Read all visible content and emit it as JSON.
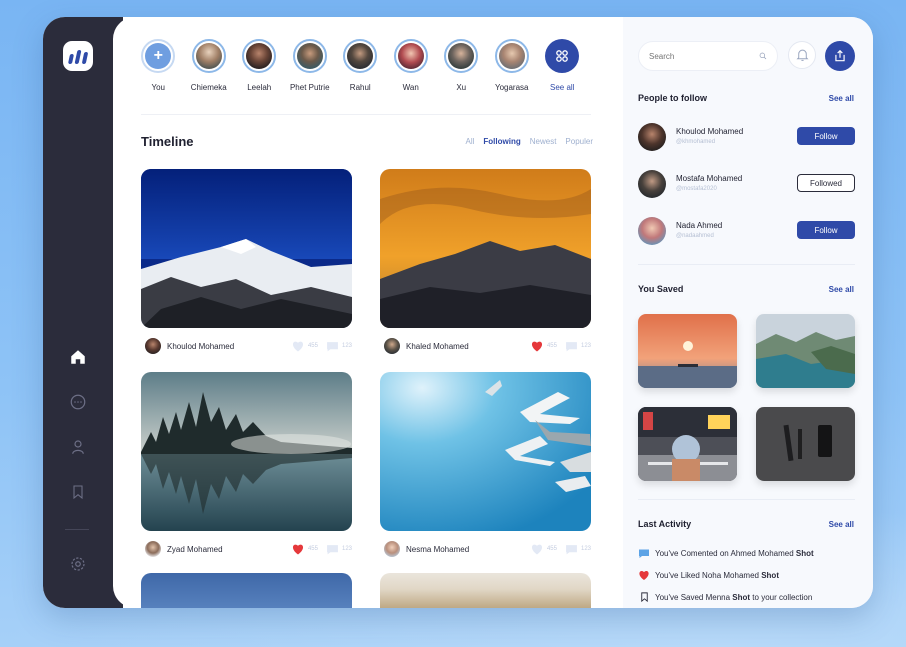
{
  "colors": {
    "accent": "#2f4aa8",
    "sidebar": "#2b2c3b",
    "like": "#e5383b",
    "story_ring": "#8db8e8"
  },
  "stories": [
    {
      "name": "You",
      "type": "add",
      "icon": "plus-icon"
    },
    {
      "name": "Chiemeka",
      "type": "user"
    },
    {
      "name": "Leelah",
      "type": "user"
    },
    {
      "name": "Phet Putrie",
      "type": "user"
    },
    {
      "name": "Rahul",
      "type": "user"
    },
    {
      "name": "Wan",
      "type": "user"
    },
    {
      "name": "Xu",
      "type": "user"
    },
    {
      "name": "Yogarasa",
      "type": "user"
    },
    {
      "name": "See all",
      "type": "more",
      "icon": "grid-icon"
    }
  ],
  "timeline": {
    "title": "Timeline",
    "filters": [
      {
        "label": "All",
        "active": false
      },
      {
        "label": "Following",
        "active": true
      },
      {
        "label": "Newest",
        "active": false
      },
      {
        "label": "Populer",
        "active": false
      }
    ],
    "posts": [
      {
        "author": "Khoulod Mohamed",
        "likes": "455",
        "comments": "123",
        "liked": false,
        "image": "snowy-mountain"
      },
      {
        "author": "Khaled Mohamed",
        "likes": "455",
        "comments": "123",
        "liked": true,
        "image": "sunset-mountain"
      },
      {
        "author": "Zyad Mohamed",
        "likes": "455",
        "comments": "123",
        "liked": true,
        "image": "forest-lake"
      },
      {
        "author": "Nesma Mohamed",
        "likes": "455",
        "comments": "123",
        "liked": false,
        "image": "seagulls-sky"
      }
    ]
  },
  "search": {
    "placeholder": "Search"
  },
  "people_to_follow": {
    "title": "People to follow",
    "see_all": "See all",
    "people": [
      {
        "name": "Khoulod Mohamed",
        "handle": "@khmohamed",
        "button": "Follow",
        "state": "follow"
      },
      {
        "name": "Mostafa Mohamed",
        "handle": "@mostafa2020",
        "button": "Followed",
        "state": "followed"
      },
      {
        "name": "Nada Ahmed",
        "handle": "@nadaahmed",
        "button": "Follow",
        "state": "follow"
      }
    ]
  },
  "you_saved": {
    "title": "You Saved",
    "see_all": "See all",
    "items": [
      "sunset-sea",
      "coastal-cliffs",
      "city-street",
      "dark-objects"
    ]
  },
  "last_activity": {
    "title": "Last Activity",
    "see_all": "See all",
    "items": [
      {
        "icon": "comment-icon",
        "pre": "You've Comented on Ahmed Mohamed ",
        "bold": "Shot",
        "post": ""
      },
      {
        "icon": "heart-icon",
        "pre": "You've Liked Noha Mohamed ",
        "bold": "Shot",
        "post": ""
      },
      {
        "icon": "bookmark-icon",
        "pre": "You've Saved Menna ",
        "bold": "Shot",
        "post": " to your collection"
      }
    ]
  }
}
